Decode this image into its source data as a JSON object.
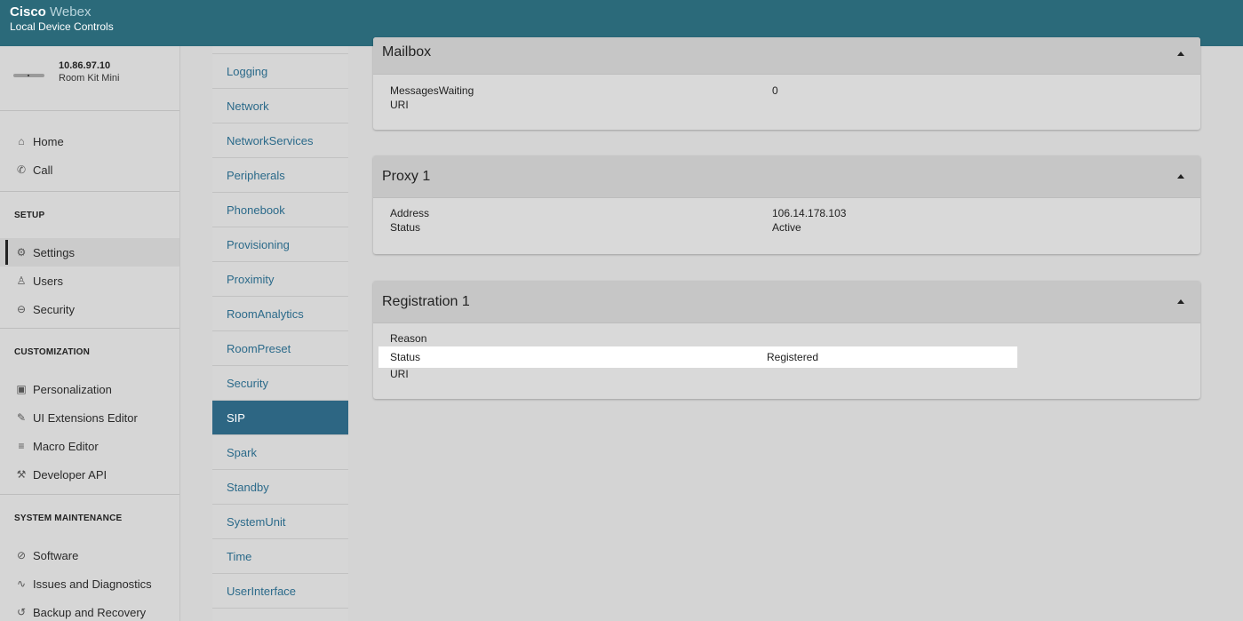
{
  "header": {
    "brand_bold": "Cisco",
    "brand_light": "Webex",
    "subtitle": "Local Device Controls"
  },
  "device": {
    "ip": "10.86.97.10",
    "model": "Room Kit Mini"
  },
  "nav": {
    "main": [
      {
        "label": "Home",
        "icon": "home-icon",
        "glyph": "⌂"
      },
      {
        "label": "Call",
        "icon": "phone-icon",
        "glyph": "✆"
      }
    ],
    "setup": {
      "heading": "SETUP",
      "items": [
        {
          "label": "Settings",
          "icon": "gear-icon",
          "glyph": "⚙"
        },
        {
          "label": "Users",
          "icon": "user-icon",
          "glyph": "♙"
        },
        {
          "label": "Security",
          "icon": "lock-icon",
          "glyph": "⊖"
        }
      ]
    },
    "customization": {
      "heading": "CUSTOMIZATION",
      "items": [
        {
          "label": "Personalization",
          "icon": "image-icon",
          "glyph": "▣"
        },
        {
          "label": "UI Extensions Editor",
          "icon": "pencil-icon",
          "glyph": "✎"
        },
        {
          "label": "Macro Editor",
          "icon": "lines-icon",
          "glyph": "≡"
        },
        {
          "label": "Developer API",
          "icon": "tools-icon",
          "glyph": "⚒"
        }
      ]
    },
    "maintenance": {
      "heading": "SYSTEM MAINTENANCE",
      "items": [
        {
          "label": "Software",
          "icon": "software-icon",
          "glyph": "⊘"
        },
        {
          "label": "Issues and Diagnostics",
          "icon": "pulse-icon",
          "glyph": "∿"
        },
        {
          "label": "Backup and Recovery",
          "icon": "history-icon",
          "glyph": "↺"
        }
      ]
    }
  },
  "categories": [
    "Logging",
    "Network",
    "NetworkServices",
    "Peripherals",
    "Phonebook",
    "Provisioning",
    "Proximity",
    "RoomAnalytics",
    "RoomPreset",
    "Security",
    "SIP",
    "Spark",
    "Standby",
    "SystemUnit",
    "Time",
    "UserInterface"
  ],
  "active_category": "SIP",
  "panels": {
    "mailbox": {
      "title": "Mailbox",
      "rows": [
        {
          "key": "MessagesWaiting",
          "value": "0"
        },
        {
          "key": "URI",
          "value": ""
        }
      ]
    },
    "proxy": {
      "title": "Proxy 1",
      "rows": [
        {
          "key": "Address",
          "value": "106.14.178.103"
        },
        {
          "key": "Status",
          "value": "Active"
        }
      ]
    },
    "registration": {
      "title": "Registration 1",
      "rows": [
        {
          "key": "Reason",
          "value": ""
        },
        {
          "key": "Status",
          "value": "Registered"
        },
        {
          "key": "URI",
          "value": ""
        }
      ]
    }
  }
}
